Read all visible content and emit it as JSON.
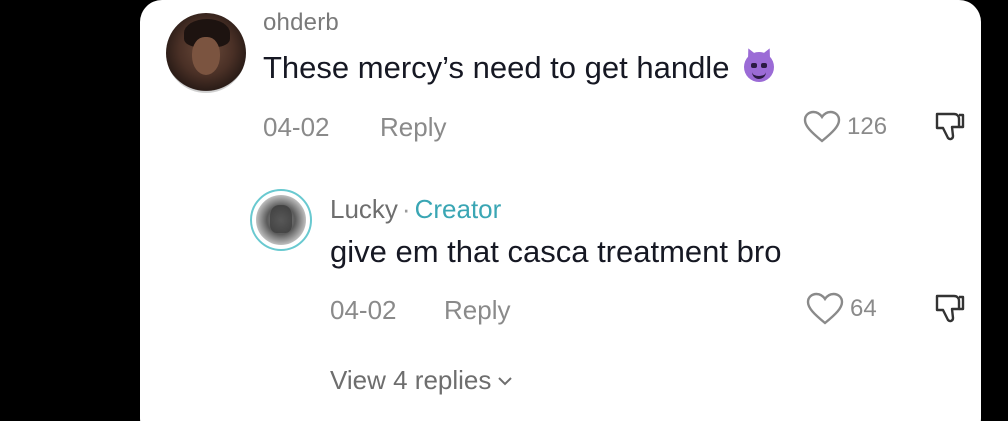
{
  "comment": {
    "username": "ohderb",
    "text": "These mercy’s need to get handle",
    "emoji": "smiling-imp-emoji",
    "date": "04-02",
    "reply_label": "Reply",
    "like_count": "126"
  },
  "reply": {
    "username": "Lucky",
    "separator": "·",
    "badge": "Creator",
    "text": "give em that casca treatment bro",
    "date": "04-02",
    "reply_label": "Reply",
    "like_count": "64"
  },
  "view_replies_label": "View 4 replies",
  "colors": {
    "background": "#000000",
    "card": "#ffffff",
    "creator_accent": "#3aa6b4",
    "meta_text": "#8a8a8a",
    "body_text": "#161823"
  }
}
